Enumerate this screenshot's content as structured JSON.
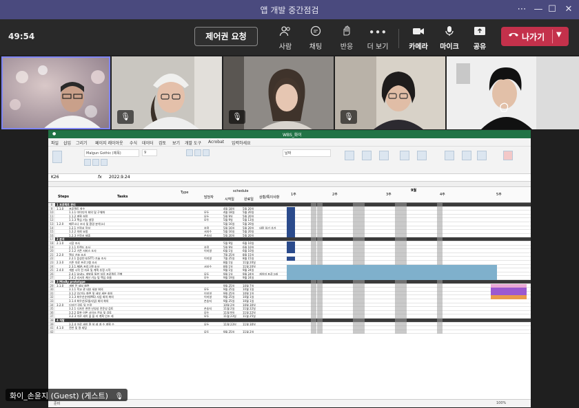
{
  "window": {
    "title": "앱 개발 중간점검"
  },
  "toolbar": {
    "timer": "49:54",
    "request_control": "제어권 요청",
    "people": "사람",
    "chat": "채팅",
    "react": "반응",
    "more": "더 보기",
    "camera": "카메라",
    "mic": "마이크",
    "share": "공유",
    "leave": "나가기"
  },
  "participants": [
    {
      "id": "p1",
      "muted": false,
      "active": true
    },
    {
      "id": "p2",
      "muted": true
    },
    {
      "id": "p3",
      "muted": true
    },
    {
      "id": "p4",
      "muted": true
    },
    {
      "id": "p5",
      "muted": false
    }
  ],
  "excel": {
    "filename": "WBS_화이",
    "menu": [
      "파일",
      "홈",
      "삽입",
      "그리기",
      "페이지 레이아웃",
      "수식",
      "데이터",
      "검토",
      "보기",
      "개발 도구",
      "Acrobat",
      "입력하세요"
    ],
    "font": "Malgun Gothic (제목)",
    "font_size": "9",
    "number_format": "날짜",
    "cell_ref": "K26",
    "formula": "2022.9.24",
    "month": "9월",
    "weeks": [
      "1주",
      "2주",
      "3주",
      "4주",
      "5주"
    ],
    "header": {
      "steps": "Steps",
      "tasks": "Tasks",
      "type": "Type",
      "owner": "담당자",
      "schedule": "schedule",
      "start": "시작일",
      "end": "완료일",
      "status": "상황/특이사항"
    },
    "sections": [
      {
        "row": "8",
        "label": "1 프로젝트 관리"
      },
      {
        "row": "17",
        "label": "2 분석"
      },
      {
        "row": "28",
        "label": "3 MinBy prototype"
      },
      {
        "row": "38",
        "label": "4 개발"
      }
    ],
    "rows": [
      {
        "n": "9",
        "step": "1.1.0",
        "task": "프로젝트 착수",
        "owner": "",
        "start": "4월 18일",
        "end": "5월 20일"
      },
      {
        "n": "10",
        "step": "",
        "task": "1.1.1   아이디어 회의 및 구체화",
        "owner": "모두",
        "start": "4월 18일",
        "end": "5월 20일"
      },
      {
        "n": "11",
        "step": "",
        "task": "1.1.2   계획 설정",
        "owner": "모두",
        "start": "5월 9일",
        "end": "5월 20일"
      },
      {
        "n": "12",
        "step": "",
        "task": "1.1.3   핵심 기능 설정",
        "owner": "모두",
        "start": "5월 9일",
        "end": "5월 13일"
      },
      {
        "n": "13",
        "step": "1.2.0",
        "task": "페르소나 조사 및 환경 분석(소)",
        "owner": "",
        "start": "5월 16일",
        "end": "5월 20일"
      },
      {
        "n": "14",
        "step": "",
        "task": "1.2.1   선정서 작성",
        "owner": "송정",
        "start": "5월 16일",
        "end": "5월 20일",
        "status": "내용 읽기 추가"
      },
      {
        "n": "15",
        "step": "",
        "task": "1.2.2   의뢰 요청",
        "owner": "서지수",
        "start": "5월 16일",
        "end": "5월 20일"
      },
      {
        "n": "16",
        "step": "",
        "task": "1.2.3   선정서 제출",
        "owner": "손송지",
        "start": "5월 20일",
        "end": "5월 20일"
      },
      {
        "n": "18",
        "step": "2.1.0",
        "task": "시장 조사",
        "owner": "",
        "start": "5월 9일",
        "end": "6월 10일"
      },
      {
        "n": "19",
        "step": "",
        "task": "2.1.1   트렌드 조사",
        "owner": "송정",
        "start": "5월 9일",
        "end": "6월 10일"
      },
      {
        "n": "20",
        "step": "",
        "task": "2.1.2   기존 서비스 조사",
        "owner": "이지영",
        "start": "6월 1일",
        "end": "6월 10일"
      },
      {
        "n": "21",
        "step": "2.2.0",
        "task": "핵심 기술 조사",
        "owner": "",
        "start": "7월 25일",
        "end": "8월 15일"
      },
      {
        "n": "22",
        "step": "",
        "task": "2.2.1   음성인식(STT) 기술 조사",
        "owner": "이지영",
        "start": "7월 25일",
        "end": "8월 15일"
      },
      {
        "n": "23",
        "step": "2.3.0",
        "task": "기존 치료 프로그램 조사",
        "owner": "",
        "start": "8월 1일",
        "end": "11월 20일"
      },
      {
        "n": "24",
        "step": "",
        "task": "2.3.1   ABA 프로그램 조사",
        "owner": "서지수",
        "start": "8월 1일",
        "end": "11월 20일"
      },
      {
        "n": "25",
        "step": "2.4.0",
        "task": "개발 시작 전 자료 및 계획 추정 시작",
        "owner": "",
        "start": "9월 1일",
        "end": "9월 24일"
      },
      {
        "n": "26",
        "step": "",
        "task": "2.4.1   Unity, 개발을 통한 실증 프로젝트 진행",
        "owner": "모두",
        "start": "9월 1일",
        "end": "9월 24일",
        "status": "게이미 프로그래"
      },
      {
        "n": "27",
        "step": "",
        "task": "2.4.2   리서치 계산 기능 및 핵심 흐름",
        "owner": "모두",
        "start": "9월 19일",
        "end": "9월 24일"
      },
      {
        "n": "29",
        "step": "3.1.0",
        "task": "개발 전 세부 화면",
        "owner": "",
        "start": "9월 25일",
        "end": "10월 7일"
      },
      {
        "n": "30",
        "step": "",
        "task": "3.1.1   학교 관 내부 세분 회의",
        "owner": "모두",
        "start": "9월 25일",
        "end": "10월 1일"
      },
      {
        "n": "31",
        "step": "",
        "task": "3.1.2   입/기능 화면 및 세부 세분 회의",
        "owner": "이지영",
        "start": "9월 25일",
        "end": "10월 1일"
      },
      {
        "n": "32",
        "step": "",
        "task": "3.1.3   최우선순위(MS) 사업 회의 화의",
        "owner": "이지영",
        "start": "9월 25일",
        "end": "10월 1일"
      },
      {
        "n": "33",
        "step": "",
        "task": "3.1.4   최우선(모듈사업) 회의 화의",
        "owner": "손송지",
        "start": "9월 25일",
        "end": "10월 1일"
      },
      {
        "n": "34",
        "step": "3.2.0",
        "task": "디자인 검토 및 수정",
        "owner": "",
        "start": "10월 2일",
        "end": "10월 30일"
      },
      {
        "n": "35",
        "step": "",
        "task": "3.2.1   디자인 관련 신빙성 전문성 검토",
        "owner": "손송지",
        "start": "11월 2일",
        "end": "11월 22일"
      },
      {
        "n": "36",
        "step": "",
        "task": "3.2.2   플롯 이론 사이즈 전부 및 검토",
        "owner": "모두",
        "start": "11월 9일",
        "end": "11월 22일"
      },
      {
        "n": "37",
        "step": "",
        "task": "3.2.3   이로 세히 플 을 라 계획 인조 레",
        "owner": "모두",
        "start": "11월 23일",
        "end": "11월 25일"
      },
      {
        "n": "39",
        "step": "",
        "task": "3.2.4   이로 세히 환 설 레 개 수 계획 수",
        "owner": "모두",
        "start": "11월 23일",
        "end": "11월 30일"
      },
      {
        "n": "41",
        "step": "4.1.0",
        "task": "전반 및 명 세팅",
        "owner": "",
        "start": "",
        "end": ""
      },
      {
        "n": "42",
        "step": "",
        "task": "",
        "owner": "모두",
        "start": "9월 25일",
        "end": "11월 2일"
      }
    ],
    "zoom": "100%"
  },
  "name_tag": "화이_손윤지 (Guest) (게스트)",
  "colors": {
    "titlebar": "#4a4a7e",
    "leave": "#c4314b",
    "excel_green": "#217346",
    "gantt_blue": "#7fb0cc",
    "gantt_navy": "#2b4b8c",
    "gantt_pink": "#e9a8d4",
    "gantt_purple": "#9b59d0",
    "gantt_orange": "#e99a4a",
    "gray_col": "#9e9e9e"
  }
}
